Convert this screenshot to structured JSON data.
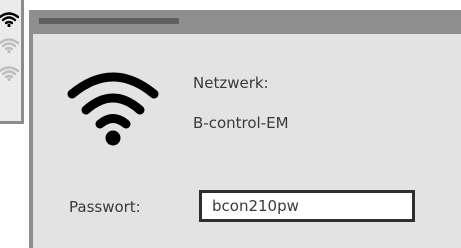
{
  "dialog": {
    "network_label": "Netzwerk:",
    "network_name": "B-control-EM",
    "password_label": "Passwort:",
    "password_value": "bcon210pw"
  },
  "icons": {
    "main": "wifi-icon",
    "background": [
      "wifi-icon",
      "wifi-icon",
      "wifi-icon"
    ]
  },
  "colors": {
    "dialog_background": "#e3e3e3",
    "frame": "#8f8f8f",
    "text": "#3a3a3a",
    "icon_dark": "#000000",
    "icon_faded": "#bdbdbd"
  }
}
